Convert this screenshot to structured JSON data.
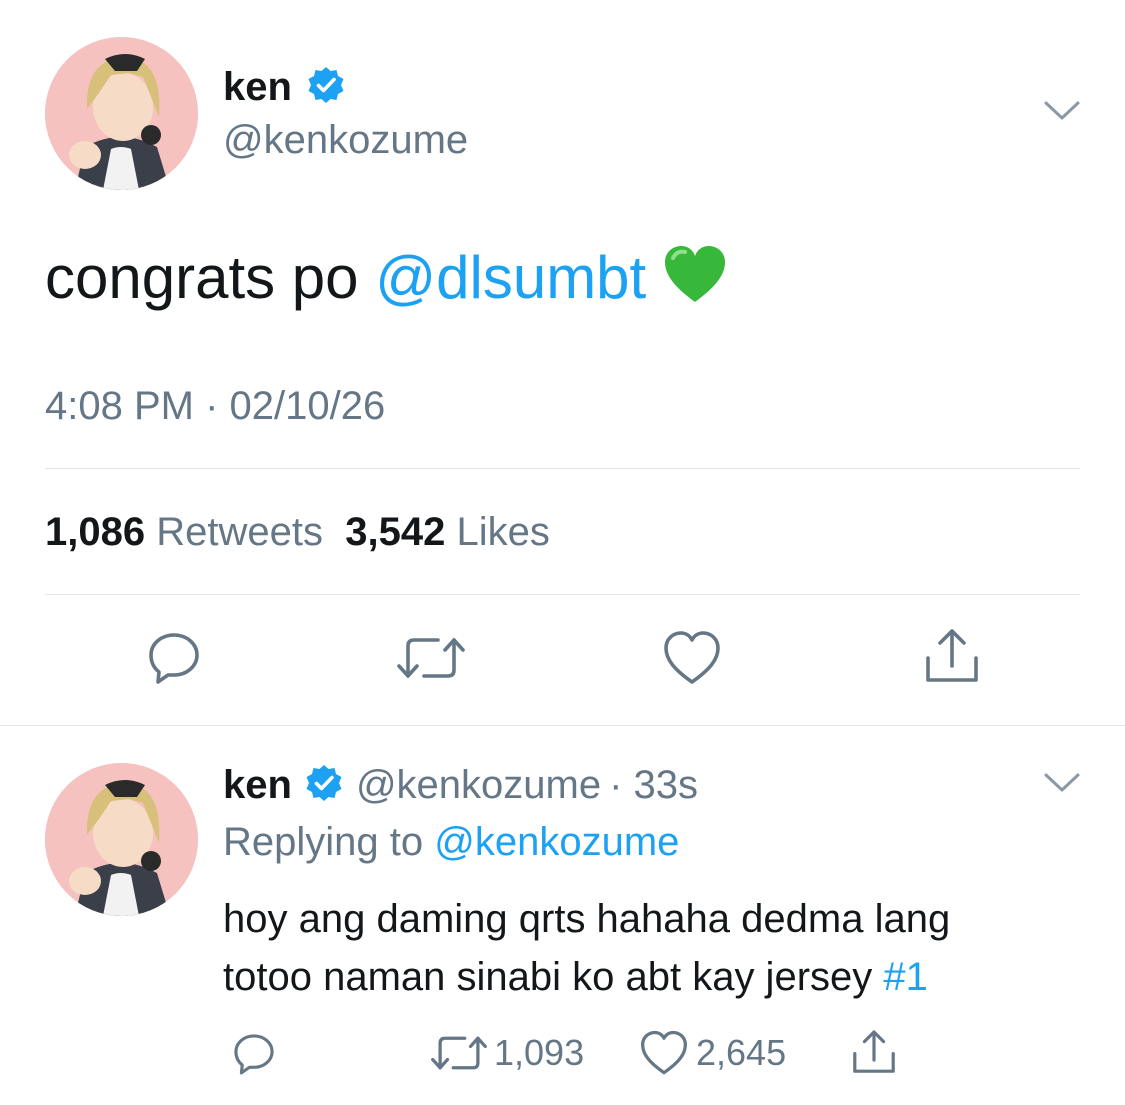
{
  "main_tweet": {
    "author": {
      "name": "ken",
      "handle": "@kenkozume"
    },
    "text_plain": "congrats po ",
    "text_mention": "@dlsumbt",
    "text_emoji": "💚",
    "timestamp": "4:08 PM · 02/10/26",
    "retweets_count": "1,086",
    "retweets_label": "Retweets",
    "likes_count": "3,542",
    "likes_label": "Likes",
    "icons": [
      "reply-icon",
      "retweet-icon",
      "like-icon",
      "share-icon",
      "chevron-down-icon",
      "verified-badge-icon"
    ]
  },
  "reply_tweet": {
    "author": {
      "name": "ken",
      "handle": "@kenkozume"
    },
    "time_ago": "· 33s",
    "replying_label": "Replying to ",
    "replying_handle": "@kenkozume",
    "text_line1": "hoy ang daming qrts hahaha dedma lang",
    "text_line2": "totoo naman sinabi ko abt kay jersey ",
    "text_hashtag": "#1",
    "retweets_count": "1,093",
    "likes_count": "2,645"
  },
  "colors": {
    "accent": "#1da1f2",
    "muted": "#657786",
    "text": "#14171a",
    "divider": "#e1e8ed",
    "heart_emoji": "#2fb52f"
  }
}
